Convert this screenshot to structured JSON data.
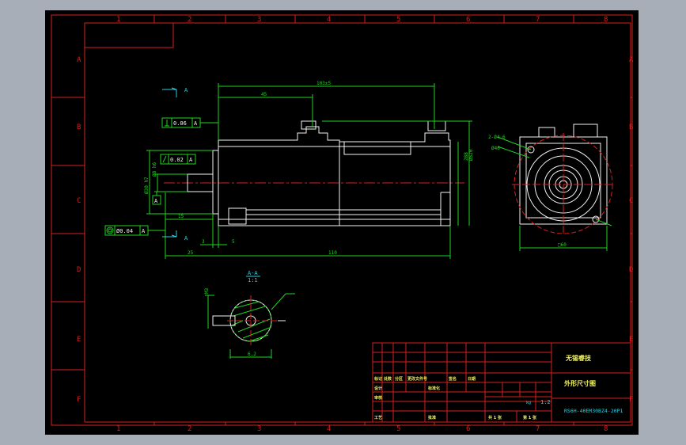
{
  "border": {
    "columns": [
      "1",
      "2",
      "3",
      "4",
      "5",
      "6",
      "7",
      "8"
    ],
    "rows": [
      "A",
      "B",
      "C",
      "D",
      "E",
      "F"
    ]
  },
  "dimensions": {
    "d_103": "103±5",
    "d_45": "45",
    "d_110": "110",
    "d_25": "25",
    "d_15": "15",
    "d_3": "3",
    "d_5": "5",
    "d_60": "□60",
    "d_62": "6.2",
    "d_h30": "Ø30 h7",
    "d_h8": "Ø8 h6",
    "d_side1": "288",
    "d_side2": "Ø520",
    "d_46": "Ø46",
    "d_4": "2-Ø4.6",
    "d_key": "M3"
  },
  "tolerances": {
    "perp": "0.06",
    "flat": "0.02",
    "conc": "Ø0.04",
    "datum": "A"
  },
  "section": {
    "label": "A-A",
    "scale": "1:1",
    "arrow_label": "A"
  },
  "title_block": {
    "company": "无锡睿技",
    "drawing_name": "外形尺寸图",
    "part_no": "RS6H-40EM30BZ4-20P1",
    "scale_value": "1:2",
    "header_cells": [
      "标记",
      "处数",
      "分区",
      "更改文件号",
      "签名",
      "日期"
    ],
    "row_labels": [
      "设计",
      "审核",
      "",
      "工艺"
    ],
    "mid_labels": [
      "标准化",
      "",
      "",
      "批准"
    ],
    "mass_label": "kg",
    "sheet_total": "共 1 张",
    "sheet_no": "第 1 张"
  }
}
